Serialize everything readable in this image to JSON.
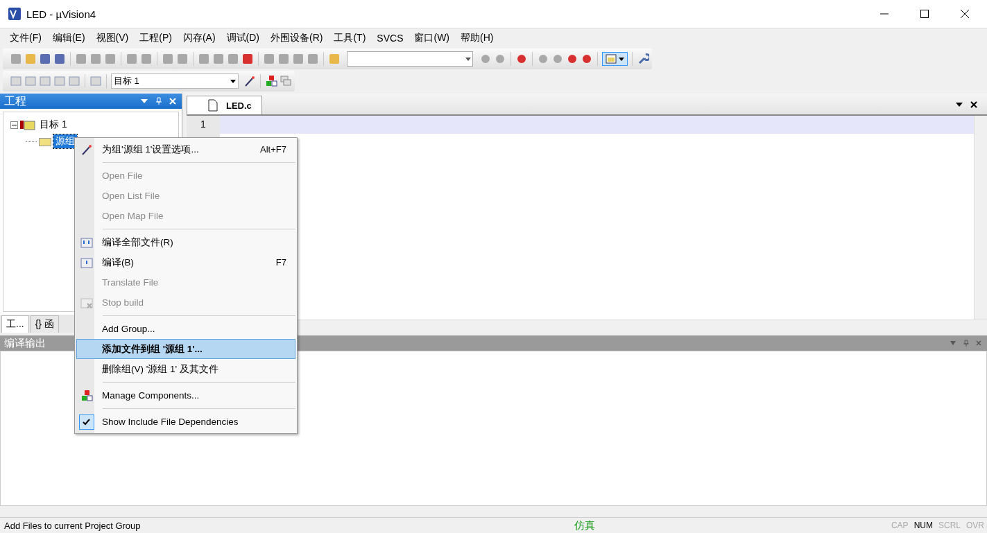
{
  "window": {
    "title": "LED  - µVision4"
  },
  "menu": [
    "文件(F)",
    "编辑(E)",
    "视图(V)",
    "工程(P)",
    "闪存(A)",
    "调试(D)",
    "外围设备(R)",
    "工具(T)",
    "SVCS",
    "窗口(W)",
    "帮助(H)"
  ],
  "toolbar": {
    "target_select": "目标 1"
  },
  "project_panel": {
    "title": "工程",
    "tree": [
      {
        "label": "目标 1",
        "expanded": true,
        "children": [
          {
            "label": "源组",
            "selected": true
          }
        ]
      }
    ],
    "tabs": [
      {
        "label": "工...",
        "selected": true
      },
      {
        "label": "{} 函",
        "selected": false
      }
    ]
  },
  "editor": {
    "tabs": [
      "LED.c"
    ],
    "line_numbers": [
      "1"
    ]
  },
  "output": {
    "title": "编译输出"
  },
  "context_menu": {
    "items": [
      {
        "kind": "item",
        "label": "为组'源组 1'设置选项...",
        "shortcut": "Alt+F7",
        "disabled": false,
        "selected": false,
        "checked": false
      },
      {
        "kind": "separator"
      },
      {
        "kind": "item",
        "label": "Open File",
        "disabled": true,
        "selected": false,
        "checked": false
      },
      {
        "kind": "item",
        "label": "Open List File",
        "disabled": true,
        "selected": false,
        "checked": false
      },
      {
        "kind": "item",
        "label": "Open Map File",
        "disabled": true,
        "selected": false,
        "checked": false
      },
      {
        "kind": "separator"
      },
      {
        "kind": "item",
        "label": "编译全部文件(R)",
        "disabled": false,
        "selected": false,
        "checked": false
      },
      {
        "kind": "item",
        "label": "编译(B)",
        "shortcut": "F7",
        "disabled": false,
        "selected": false,
        "checked": false
      },
      {
        "kind": "item",
        "label": "Translate File",
        "disabled": true,
        "selected": false,
        "checked": false
      },
      {
        "kind": "item",
        "label": "Stop build",
        "disabled": true,
        "selected": false,
        "checked": false
      },
      {
        "kind": "separator"
      },
      {
        "kind": "item",
        "label": "Add Group...",
        "disabled": false,
        "selected": false,
        "checked": false
      },
      {
        "kind": "item",
        "label": "添加文件到组 '源组 1'...",
        "disabled": false,
        "selected": true,
        "checked": false
      },
      {
        "kind": "item",
        "label": "删除组(V) '源组 1' 及其文件",
        "disabled": false,
        "selected": false,
        "checked": false
      },
      {
        "kind": "separator"
      },
      {
        "kind": "item",
        "label": "Manage Components...",
        "disabled": false,
        "selected": false,
        "checked": false
      },
      {
        "kind": "separator"
      },
      {
        "kind": "item",
        "label": "Show Include File Dependencies",
        "disabled": false,
        "selected": false,
        "checked": true
      }
    ]
  },
  "status_bar": {
    "text": "Add Files to current Project Group",
    "mode": "仿真",
    "indicators": [
      {
        "label": "CAP",
        "on": false
      },
      {
        "label": "NUM",
        "on": true
      },
      {
        "label": "SCRL",
        "on": false
      },
      {
        "label": "OVR",
        "on": false
      }
    ]
  }
}
